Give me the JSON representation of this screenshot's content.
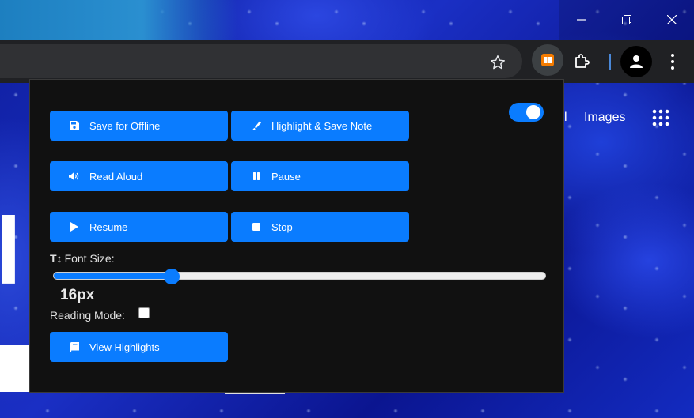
{
  "window": {
    "controls": [
      "minimize",
      "restore",
      "close"
    ]
  },
  "browser": {
    "toolbar_icons": [
      "star-icon",
      "extension-book-icon",
      "puzzle-icon",
      "profile-icon",
      "menu-dots-icon"
    ]
  },
  "page": {
    "images_link": "Images",
    "separator": "l",
    "big_letter": "l"
  },
  "popup": {
    "toggle_enabled": true,
    "buttons": {
      "save_offline": "Save for Offline",
      "highlight_save": "Highlight & Save Note",
      "read_aloud": "Read Aloud",
      "pause": "Pause",
      "resume": "Resume",
      "stop": "Stop",
      "view_highlights": "View Highlights"
    },
    "font_size_label": "Font Size:",
    "font_size_value": "16px",
    "font_size_slider_fraction": 0.24,
    "reading_mode_label": "Reading Mode:",
    "reading_mode_checked": false
  },
  "colors": {
    "accent": "#0a7cff",
    "popup_bg": "#111111",
    "toolbar_bg": "#202124"
  }
}
